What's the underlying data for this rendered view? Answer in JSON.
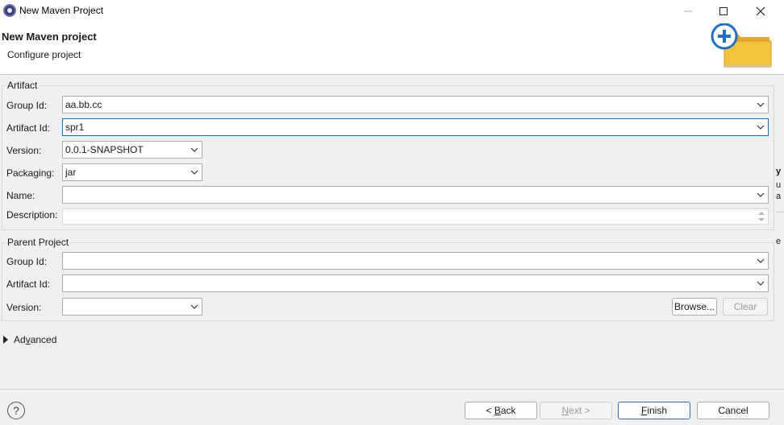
{
  "window": {
    "title": "New Maven Project",
    "controls": [
      "minimize",
      "maximize",
      "close"
    ]
  },
  "header": {
    "title": "New Maven project",
    "subtitle": "Configure project",
    "icon": "new-folder-wizard-icon"
  },
  "artifact": {
    "legend": "Artifact",
    "group_id": {
      "label": "Group Id:",
      "value": "aa.bb.cc"
    },
    "artifact_id": {
      "label": "Artifact Id:",
      "value": "spr1"
    },
    "version": {
      "label": "Version:",
      "value": "0.0.1-SNAPSHOT"
    },
    "packaging": {
      "label": "Packaging:",
      "value": "jar"
    },
    "name": {
      "label": "Name:",
      "value": ""
    },
    "description": {
      "label": "Description:",
      "value": ""
    }
  },
  "parent": {
    "legend": "Parent Project",
    "group_id": {
      "label": "Group Id:",
      "value": ""
    },
    "artifact_id": {
      "label": "Artifact Id:",
      "value": ""
    },
    "version": {
      "label": "Version:",
      "value": ""
    },
    "browse_label": "Browse...",
    "clear_label": "Clear"
  },
  "advanced": {
    "prefix": "Ad",
    "mnemonic": "v",
    "suffix": "anced"
  },
  "footer": {
    "back": {
      "prefix": "< ",
      "mnemonic": "B",
      "suffix": "ack"
    },
    "next": {
      "mnemonic": "N",
      "suffix": "ext >"
    },
    "finish": {
      "mnemonic": "F",
      "suffix": "inish"
    },
    "cancel": "Cancel",
    "help_symbol": "?"
  },
  "background_window_fragments": [
    "y",
    "u",
    "a",
    "",
    "",
    "",
    "",
    "",
    "e"
  ],
  "colors": {
    "focus_border": "#0a6ec7",
    "wizard_icon_blue": "#1e6fd0",
    "folder_yellow": "#f3c43a"
  }
}
